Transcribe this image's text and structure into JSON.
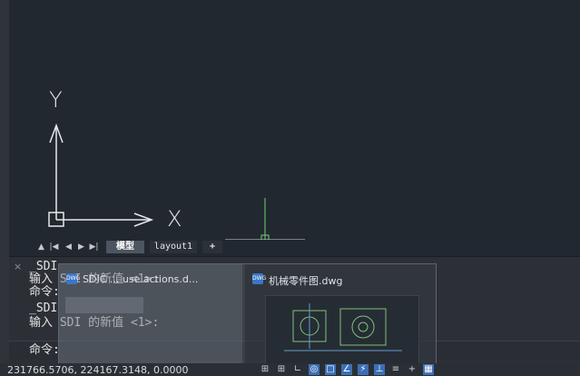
{
  "canvas": {
    "ucs_y_label": "Y",
    "ucs_x_label": "X"
  },
  "layout_tabs": {
    "nav_first": "▲",
    "nav_prev_all": "|◀",
    "nav_prev": "◀",
    "nav_next": "▶",
    "nav_last": "▶|",
    "tabs": [
      {
        "label": "模型",
        "active": true
      },
      {
        "label": "layout1",
        "active": false
      }
    ],
    "add_label": "+"
  },
  "command_window": {
    "close_icon": "×",
    "lines": [
      "_SDI",
      "输入 SDI 的新值 <1>:",
      "命令:",
      "_SDI",
      "输入 SDI 的新值 <1>:",
      "命令:"
    ]
  },
  "preview": {
    "thumb1_title": "SDIC ... use actions.d...",
    "thumb2_title": "机械零件图.dwg",
    "thumb_icon": "DWG"
  },
  "status_bar": {
    "coordinates": "231766.5706, 224167.3148, 0.0000",
    "buttons": [
      {
        "icon": "grid-icon",
        "glyph": "⊞",
        "on": false
      },
      {
        "icon": "snap-grid-icon",
        "glyph": "⊞",
        "on": false
      },
      {
        "icon": "ortho-icon",
        "glyph": "∟",
        "on": false
      },
      {
        "icon": "polar-icon",
        "glyph": "◎",
        "on": true
      },
      {
        "icon": "osnap-icon",
        "glyph": "□",
        "on": true
      },
      {
        "icon": "otrack-icon",
        "glyph": "∠",
        "on": true
      },
      {
        "icon": "dyn-icon",
        "glyph": "⚡",
        "on": true
      },
      {
        "icon": "lweight-icon",
        "glyph": "⊥",
        "on": true
      },
      {
        "icon": "menu-icon",
        "glyph": "≡",
        "on": false
      },
      {
        "icon": "plus-icon",
        "glyph": "+",
        "on": false
      },
      {
        "icon": "model-space-icon",
        "glyph": "▦",
        "on": true
      }
    ]
  },
  "colors": {
    "canvas_bg": "#212830",
    "ucs": "#e8e8e8",
    "cursor_green": "#6fd36f",
    "status_on": "#3c6fb6"
  }
}
